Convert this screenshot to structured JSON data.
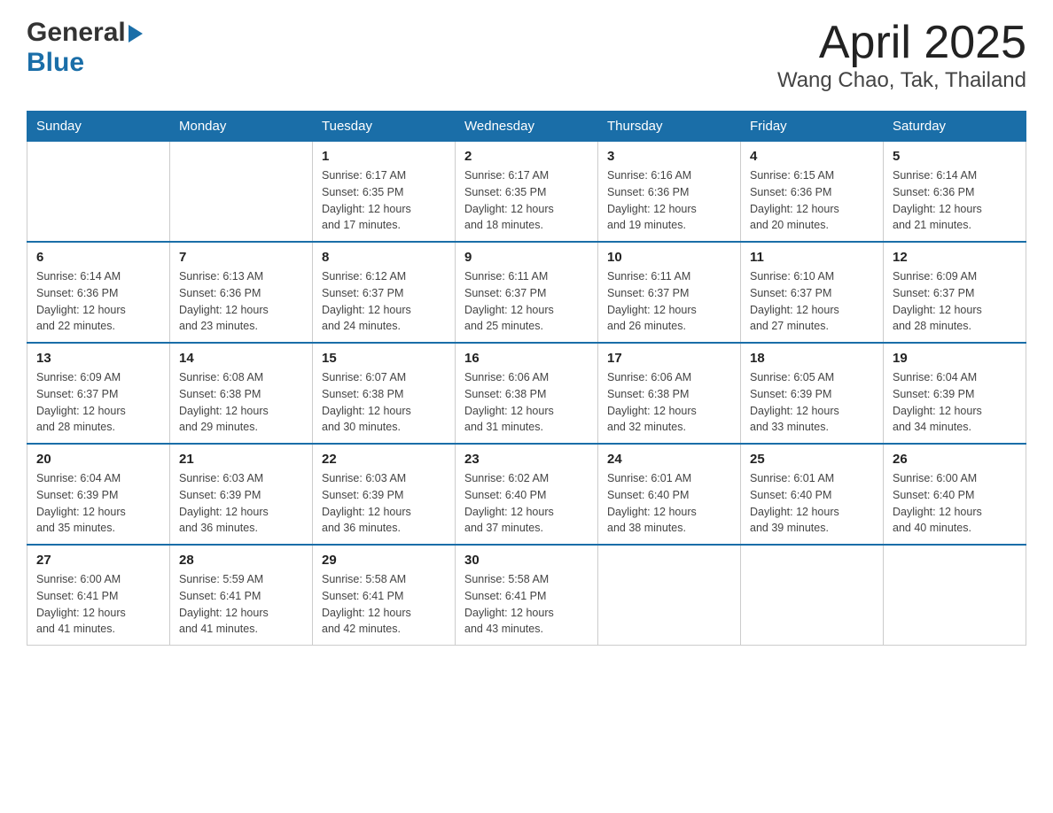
{
  "header": {
    "logo_general": "General",
    "logo_blue": "Blue",
    "title": "April 2025",
    "subtitle": "Wang Chao, Tak, Thailand"
  },
  "calendar": {
    "days_of_week": [
      "Sunday",
      "Monday",
      "Tuesday",
      "Wednesday",
      "Thursday",
      "Friday",
      "Saturday"
    ],
    "weeks": [
      [
        {
          "day": "",
          "info": ""
        },
        {
          "day": "",
          "info": ""
        },
        {
          "day": "1",
          "info": "Sunrise: 6:17 AM\nSunset: 6:35 PM\nDaylight: 12 hours\nand 17 minutes."
        },
        {
          "day": "2",
          "info": "Sunrise: 6:17 AM\nSunset: 6:35 PM\nDaylight: 12 hours\nand 18 minutes."
        },
        {
          "day": "3",
          "info": "Sunrise: 6:16 AM\nSunset: 6:36 PM\nDaylight: 12 hours\nand 19 minutes."
        },
        {
          "day": "4",
          "info": "Sunrise: 6:15 AM\nSunset: 6:36 PM\nDaylight: 12 hours\nand 20 minutes."
        },
        {
          "day": "5",
          "info": "Sunrise: 6:14 AM\nSunset: 6:36 PM\nDaylight: 12 hours\nand 21 minutes."
        }
      ],
      [
        {
          "day": "6",
          "info": "Sunrise: 6:14 AM\nSunset: 6:36 PM\nDaylight: 12 hours\nand 22 minutes."
        },
        {
          "day": "7",
          "info": "Sunrise: 6:13 AM\nSunset: 6:36 PM\nDaylight: 12 hours\nand 23 minutes."
        },
        {
          "day": "8",
          "info": "Sunrise: 6:12 AM\nSunset: 6:37 PM\nDaylight: 12 hours\nand 24 minutes."
        },
        {
          "day": "9",
          "info": "Sunrise: 6:11 AM\nSunset: 6:37 PM\nDaylight: 12 hours\nand 25 minutes."
        },
        {
          "day": "10",
          "info": "Sunrise: 6:11 AM\nSunset: 6:37 PM\nDaylight: 12 hours\nand 26 minutes."
        },
        {
          "day": "11",
          "info": "Sunrise: 6:10 AM\nSunset: 6:37 PM\nDaylight: 12 hours\nand 27 minutes."
        },
        {
          "day": "12",
          "info": "Sunrise: 6:09 AM\nSunset: 6:37 PM\nDaylight: 12 hours\nand 28 minutes."
        }
      ],
      [
        {
          "day": "13",
          "info": "Sunrise: 6:09 AM\nSunset: 6:37 PM\nDaylight: 12 hours\nand 28 minutes."
        },
        {
          "day": "14",
          "info": "Sunrise: 6:08 AM\nSunset: 6:38 PM\nDaylight: 12 hours\nand 29 minutes."
        },
        {
          "day": "15",
          "info": "Sunrise: 6:07 AM\nSunset: 6:38 PM\nDaylight: 12 hours\nand 30 minutes."
        },
        {
          "day": "16",
          "info": "Sunrise: 6:06 AM\nSunset: 6:38 PM\nDaylight: 12 hours\nand 31 minutes."
        },
        {
          "day": "17",
          "info": "Sunrise: 6:06 AM\nSunset: 6:38 PM\nDaylight: 12 hours\nand 32 minutes."
        },
        {
          "day": "18",
          "info": "Sunrise: 6:05 AM\nSunset: 6:39 PM\nDaylight: 12 hours\nand 33 minutes."
        },
        {
          "day": "19",
          "info": "Sunrise: 6:04 AM\nSunset: 6:39 PM\nDaylight: 12 hours\nand 34 minutes."
        }
      ],
      [
        {
          "day": "20",
          "info": "Sunrise: 6:04 AM\nSunset: 6:39 PM\nDaylight: 12 hours\nand 35 minutes."
        },
        {
          "day": "21",
          "info": "Sunrise: 6:03 AM\nSunset: 6:39 PM\nDaylight: 12 hours\nand 36 minutes."
        },
        {
          "day": "22",
          "info": "Sunrise: 6:03 AM\nSunset: 6:39 PM\nDaylight: 12 hours\nand 36 minutes."
        },
        {
          "day": "23",
          "info": "Sunrise: 6:02 AM\nSunset: 6:40 PM\nDaylight: 12 hours\nand 37 minutes."
        },
        {
          "day": "24",
          "info": "Sunrise: 6:01 AM\nSunset: 6:40 PM\nDaylight: 12 hours\nand 38 minutes."
        },
        {
          "day": "25",
          "info": "Sunrise: 6:01 AM\nSunset: 6:40 PM\nDaylight: 12 hours\nand 39 minutes."
        },
        {
          "day": "26",
          "info": "Sunrise: 6:00 AM\nSunset: 6:40 PM\nDaylight: 12 hours\nand 40 minutes."
        }
      ],
      [
        {
          "day": "27",
          "info": "Sunrise: 6:00 AM\nSunset: 6:41 PM\nDaylight: 12 hours\nand 41 minutes."
        },
        {
          "day": "28",
          "info": "Sunrise: 5:59 AM\nSunset: 6:41 PM\nDaylight: 12 hours\nand 41 minutes."
        },
        {
          "day": "29",
          "info": "Sunrise: 5:58 AM\nSunset: 6:41 PM\nDaylight: 12 hours\nand 42 minutes."
        },
        {
          "day": "30",
          "info": "Sunrise: 5:58 AM\nSunset: 6:41 PM\nDaylight: 12 hours\nand 43 minutes."
        },
        {
          "day": "",
          "info": ""
        },
        {
          "day": "",
          "info": ""
        },
        {
          "day": "",
          "info": ""
        }
      ]
    ]
  }
}
